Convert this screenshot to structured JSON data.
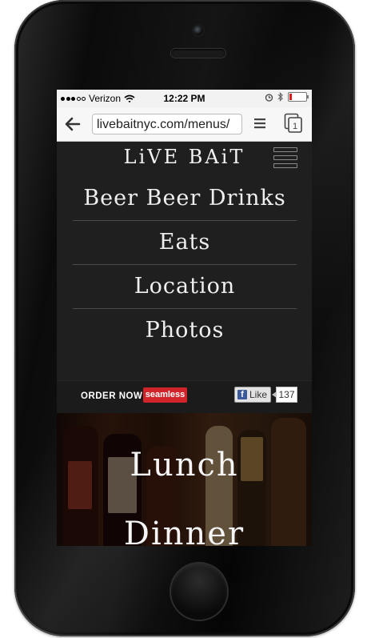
{
  "status_bar": {
    "carrier": "Verizon",
    "time": "12:22 PM",
    "battery_level": 0.15
  },
  "browser": {
    "url": "livebaitnyc.com/menus/",
    "icons": [
      "back-arrow-icon",
      "list-icon",
      "tabs-icon"
    ],
    "tab_count": "1"
  },
  "site": {
    "brand": "LiVE BAiT",
    "nav": [
      {
        "label": "Beer Beer Drinks"
      },
      {
        "label": "Eats"
      },
      {
        "label": "Location"
      },
      {
        "label": "Photos"
      }
    ],
    "order_now": "ORDER NOW",
    "seamless": "seamless",
    "fb_logo": "f",
    "like_label": "Like",
    "like_count": "137",
    "hero_lines": [
      "Lunch",
      "Dinner"
    ]
  },
  "colors": {
    "background": "#1f1f1f",
    "seamless_red": "#d1232a",
    "facebook_blue": "#3b5a9a"
  }
}
